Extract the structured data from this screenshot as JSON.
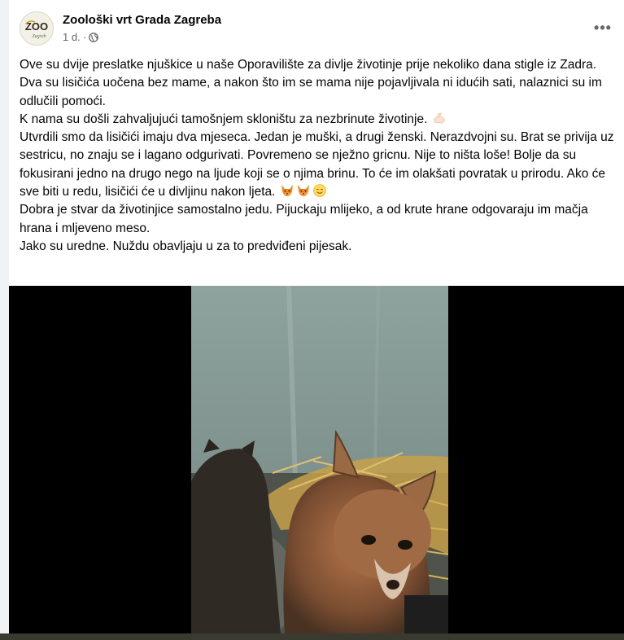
{
  "post": {
    "page_name": "Zoološki vrt Grada Zagreba",
    "time": "1 d.",
    "separator": "·",
    "privacy_icon": "globe-icon",
    "more_icon": "more-options-icon",
    "more_label": "•••",
    "avatar_logo": {
      "line1": "ZOO",
      "line2": "Zagreb"
    },
    "lines": [
      {
        "text": "Ove su dvije preslatke njuškice u naše Oporavilište za divlje životinje prije nekoliko dana stigle iz Zadra."
      },
      {
        "text": "Dva su lisičića uočena bez mame, a nakon što im se mama nije pojavljivala ni idućih sati, nalaznici su im odlučili pomoći."
      },
      {
        "text": "K nama su došli zahvaljujući tamošnjem skloništu za nezbrinute životinje.",
        "emoji": [
          "flexed-biceps-emoji"
        ]
      },
      {
        "text": "Utvrdili smo da lisičići imaju dva mjeseca. Jedan je muški, a drugi ženski. Nerazdvojni su. Brat se privija uz sestricu, no znaju se i lagano odgurivati. Povremeno se nježno gricnu. Nije to ništa loše! Bolje da su fokusirani jedno na drugo nego na ljude koji se o njima brinu. To će im olakšati povratak u prirodu. Ako će sve biti u redu, lisičići će u divljinu nakon ljeta.",
        "emoji": [
          "fox-emoji",
          "fox-emoji",
          "smiling-face-emoji"
        ]
      },
      {
        "text": "Dobra je stvar da životinjice samostalno jedu. Pijuckaju mlijeko, a od krute hrane odgovaraju im mačja hrana i mljeveno meso."
      },
      {
        "text": "Jako su uredne. Nuždu obavljaju u za to predviđeni pijesak."
      }
    ]
  },
  "colors": {
    "text": "#050505",
    "meta": "#65676b",
    "video_bg": "#000000",
    "page_bg": "#f0f2f5"
  },
  "media": {
    "type": "video",
    "subject": "two fox cubs on straw"
  }
}
